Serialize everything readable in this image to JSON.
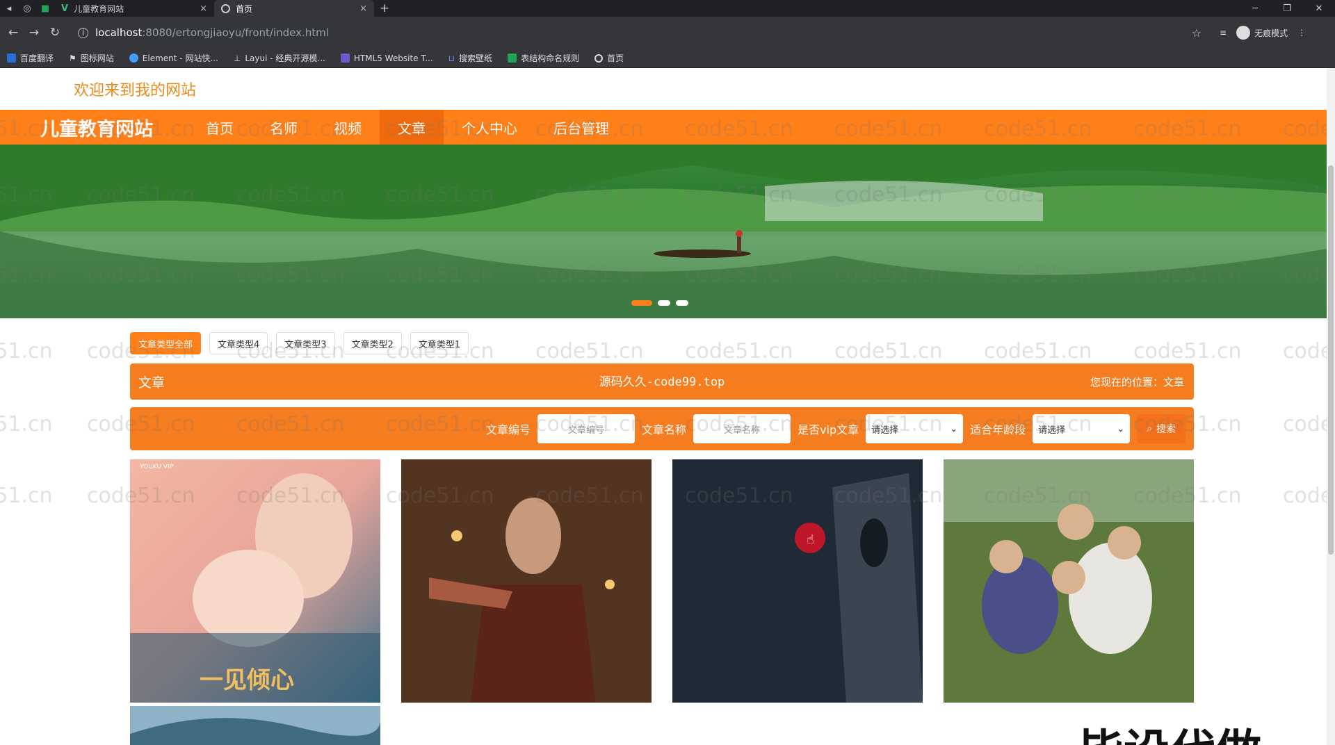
{
  "browser": {
    "tabs": [
      {
        "title": "儿童教育网站",
        "close": "×"
      },
      {
        "title": "首页",
        "close": "×"
      }
    ],
    "new_tab": "+",
    "url_host": "localhost",
    "url_path": ":8080/ertongjiaoyu/front/index.html",
    "incognito_label": "无痕模式",
    "bookmarks": [
      {
        "label": "百度翻译",
        "color": "#2b6cd8"
      },
      {
        "label": "图标网站",
        "color": "#ffffff"
      },
      {
        "label": "Element - 网站快...",
        "color": "#409eff"
      },
      {
        "label": "Layui - 经典开源模...",
        "color": "#ffffff"
      },
      {
        "label": "HTML5 Website T...",
        "color": "#6a5acd"
      },
      {
        "label": "搜索壁纸",
        "color": "#3060d0"
      },
      {
        "label": "表结构命名规则",
        "color": "#22a455"
      },
      {
        "label": "首页",
        "color": "#dddddd"
      }
    ]
  },
  "site": {
    "welcome": "欢迎来到我的网站",
    "title": "儿童教育网站",
    "nav": [
      "首页",
      "名师",
      "视频",
      "文章",
      "个人中心",
      "后台管理"
    ],
    "active_nav_index": 3,
    "accent_color": "#ff7f19"
  },
  "banner": {
    "slides": 3,
    "active_slide": 0
  },
  "type_tabs": [
    "文章类型全部",
    "文章类型4",
    "文章类型3",
    "文章类型2",
    "文章类型1"
  ],
  "titlebar": {
    "left": "文章",
    "center": "源码久久-code99.top",
    "right": "您现在的位置：文章"
  },
  "search": {
    "field1_label": "文章编号",
    "field1_placeholder": "文章编号",
    "field2_label": "文章名称",
    "field2_placeholder": "文章名称",
    "select1_label": "是否vip文章",
    "select1_value": "请选择",
    "select2_label": "适合年龄段",
    "select2_value": "请选择",
    "button_label": "搜索"
  },
  "cards": [
    {
      "caption": "一见倾心",
      "badge": "YOUKU VIP"
    },
    {
      "caption": ""
    },
    {
      "caption": ""
    },
    {
      "caption": ""
    },
    {
      "caption": ""
    }
  ],
  "watermark": "code51.cn",
  "stamp": "毕设代做"
}
